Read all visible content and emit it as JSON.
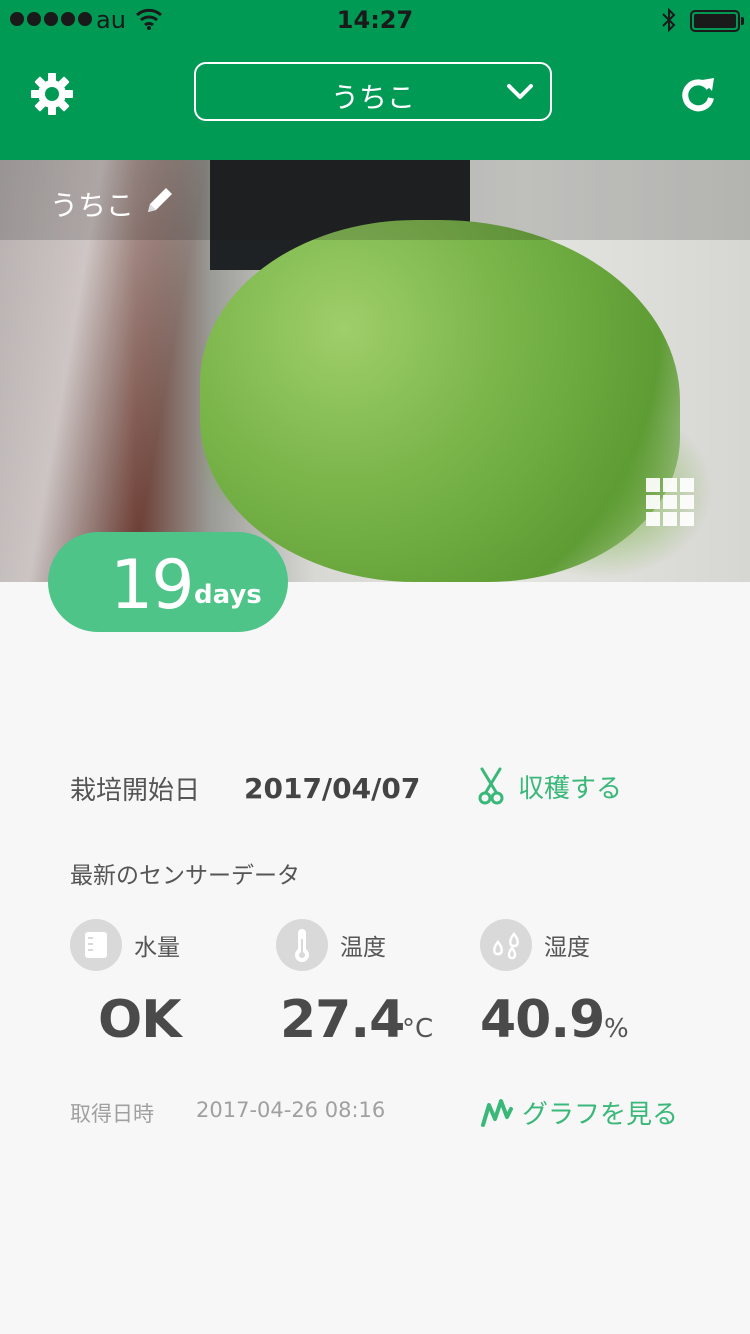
{
  "status_bar": {
    "carrier": "au",
    "time": "14:27"
  },
  "header": {
    "plant_selector": "うちこ"
  },
  "photo": {
    "plant_name": "うちこ"
  },
  "days": {
    "count": "19",
    "unit": "days"
  },
  "cultivation": {
    "start_label": "栽培開始日",
    "start_date": "2017/04/07",
    "harvest_label": "収穫する"
  },
  "sensor": {
    "title": "最新のセンサーデータ",
    "water": {
      "label": "水量",
      "value": "OK"
    },
    "temperature": {
      "label": "温度",
      "value": "27.4",
      "unit": "°C"
    },
    "humidity": {
      "label": "湿度",
      "value": "40.9",
      "unit": "%"
    },
    "fetched_label": "取得日時",
    "fetched_at": "2017-04-26 08:16",
    "graph_label": "グラフを見る"
  },
  "colors": {
    "primary": "#009a55",
    "accent": "#4ec488",
    "link": "#3ab879"
  }
}
